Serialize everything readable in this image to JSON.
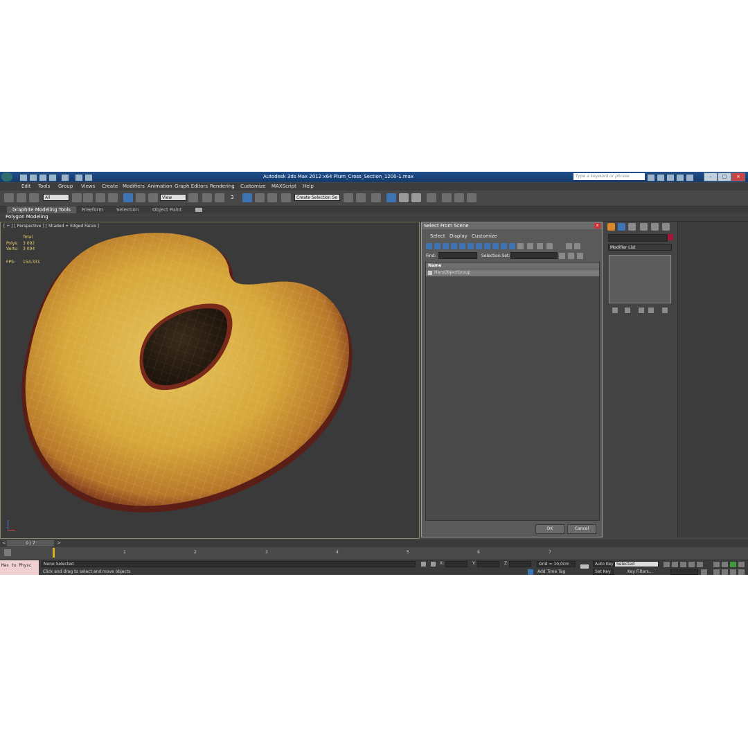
{
  "title_bar": {
    "title": "Autodesk 3ds Max  2012 x64     Plum_Cross_Section_1200-1.max",
    "search_placeholder": "Type a keyword or phrase"
  },
  "menu": [
    "Edit",
    "Tools",
    "Group",
    "Views",
    "Create",
    "Modifiers",
    "Animation",
    "Graph Editors",
    "Rendering",
    "Customize",
    "MAXScript",
    "Help"
  ],
  "toolbar": {
    "filter_select": "All",
    "coord_select": "View",
    "snap_label": "3",
    "selection_set": "Create Selection Se"
  },
  "ribbon": {
    "tabs": [
      "Graphite Modeling Tools",
      "Freeform",
      "Selection",
      "Object Paint"
    ],
    "sub_label": "Polygon Modeling"
  },
  "viewport": {
    "label": "[ + ] [ Perspective ] [ Shaded + Edged Faces ]",
    "stats_total": "Total",
    "polys_label": "Polys:",
    "polys_value": "3 092",
    "verts_label": "Verts:",
    "verts_value": "3 094",
    "fps_label": "FPS:",
    "fps_value": "154,331"
  },
  "dialog": {
    "title": "Select From Scene",
    "close": "x",
    "menus": [
      "Select",
      "Display",
      "Customize"
    ],
    "find_label": "Find:",
    "selection_set_label": "Selection Set:",
    "column_name": "Name",
    "items": [
      "HeroObjectGroup"
    ],
    "ok": "OK",
    "cancel": "Cancel"
  },
  "command_panel": {
    "modifier_list": "Modifier List"
  },
  "timeline": {
    "frame_counter": "0 / 7",
    "ticks": [
      "1",
      "2",
      "3",
      "4",
      "5",
      "6",
      "7"
    ],
    "slider_left": "<",
    "slider_right": ">"
  },
  "status_bar": {
    "maxscript": "Max to Physc",
    "selection": "None Selected",
    "prompt": "Click and drag to select and move objects",
    "x_label": "X:",
    "y_label": "Y:",
    "z_label": "Z:",
    "grid": "Grid = 10,0cm",
    "add_time_tag": "Add Time Tag",
    "auto_key": "Auto Key",
    "auto_key_select": "Selected",
    "set_key": "Set Key",
    "key_filters": "Key Filters..."
  },
  "colors": {
    "title_bar": "#1f4f8c",
    "ui_background": "#444444",
    "viewport_stats": "#ebd46a",
    "active_tool": "#3d74b4"
  }
}
